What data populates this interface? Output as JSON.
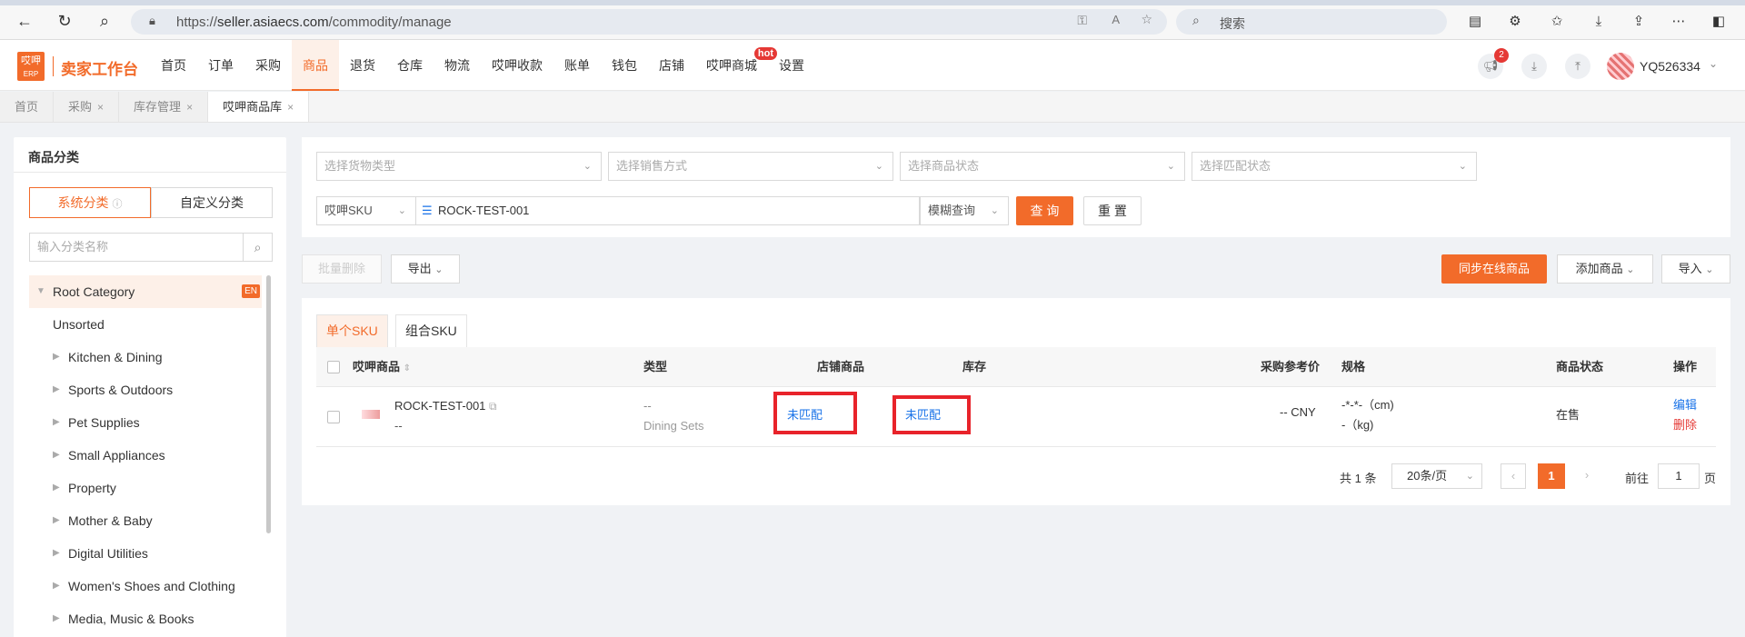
{
  "browser": {
    "url_prefix": "https://",
    "url_host": "seller.asiaecs.com",
    "url_path": "/commodity/manage",
    "search_placeholder": "搜索"
  },
  "header": {
    "logo_top": "哎呷",
    "logo_bottom": "ERP",
    "title": "卖家工作台",
    "nav": [
      "首页",
      "订单",
      "采购",
      "商品",
      "退货",
      "仓库",
      "物流",
      "哎呷收款",
      "账单",
      "钱包",
      "店铺",
      "哎呷商城",
      "设置"
    ],
    "hot_label": "hot",
    "notif_count": "2",
    "user": "YQ526334"
  },
  "tabs": [
    "首页",
    "采购",
    "库存管理",
    "哎呷商品库"
  ],
  "left": {
    "title": "商品分类",
    "seg_system": "系统分类",
    "seg_custom": "自定义分类",
    "search_placeholder": "输入分类名称",
    "root": "Root Category",
    "root_tag": "EN",
    "unsorted": "Unsorted",
    "categories": [
      "Kitchen & Dining",
      "Sports & Outdoors",
      "Pet Supplies",
      "Small Appliances",
      "Property",
      "Mother & Baby",
      "Digital Utilities",
      "Women's Shoes and Clothing",
      "Media, Music & Books"
    ]
  },
  "filters": {
    "goods_type": "选择货物类型",
    "sale_method": "选择销售方式",
    "product_status": "选择商品状态",
    "match_status": "选择匹配状态",
    "sku_field": "哎呷SKU",
    "sku_value": "ROCK-TEST-001",
    "fuzzy": "模糊查询",
    "query_btn": "查 询",
    "reset_btn": "重 置"
  },
  "actions": {
    "batch_delete": "批量删除",
    "export": "导出",
    "sync": "同步在线商品",
    "add": "添加商品",
    "import": "导入"
  },
  "table": {
    "tab_single": "单个SKU",
    "tab_combo": "组合SKU",
    "headers": {
      "product": "哎呷商品",
      "type": "类型",
      "shop": "店铺商品",
      "stock": "库存",
      "price": "采购参考价",
      "spec": "规格",
      "status": "商品状态",
      "ops": "操作"
    },
    "row": {
      "sku": "ROCK-TEST-001",
      "sub": "--",
      "type_main": "--",
      "type_sub": "Dining Sets",
      "shop": "未匹配",
      "stock": "未匹配",
      "price": "-- CNY",
      "spec_size": "-*-*-（cm)",
      "spec_weight": "-（kg)",
      "status": "在售",
      "edit": "编辑",
      "delete": "删除"
    }
  },
  "pager": {
    "total": "共 1 条",
    "page_size": "20条/页",
    "current": "1",
    "goto_label": "前往",
    "goto_value": "1",
    "page_unit": "页"
  }
}
